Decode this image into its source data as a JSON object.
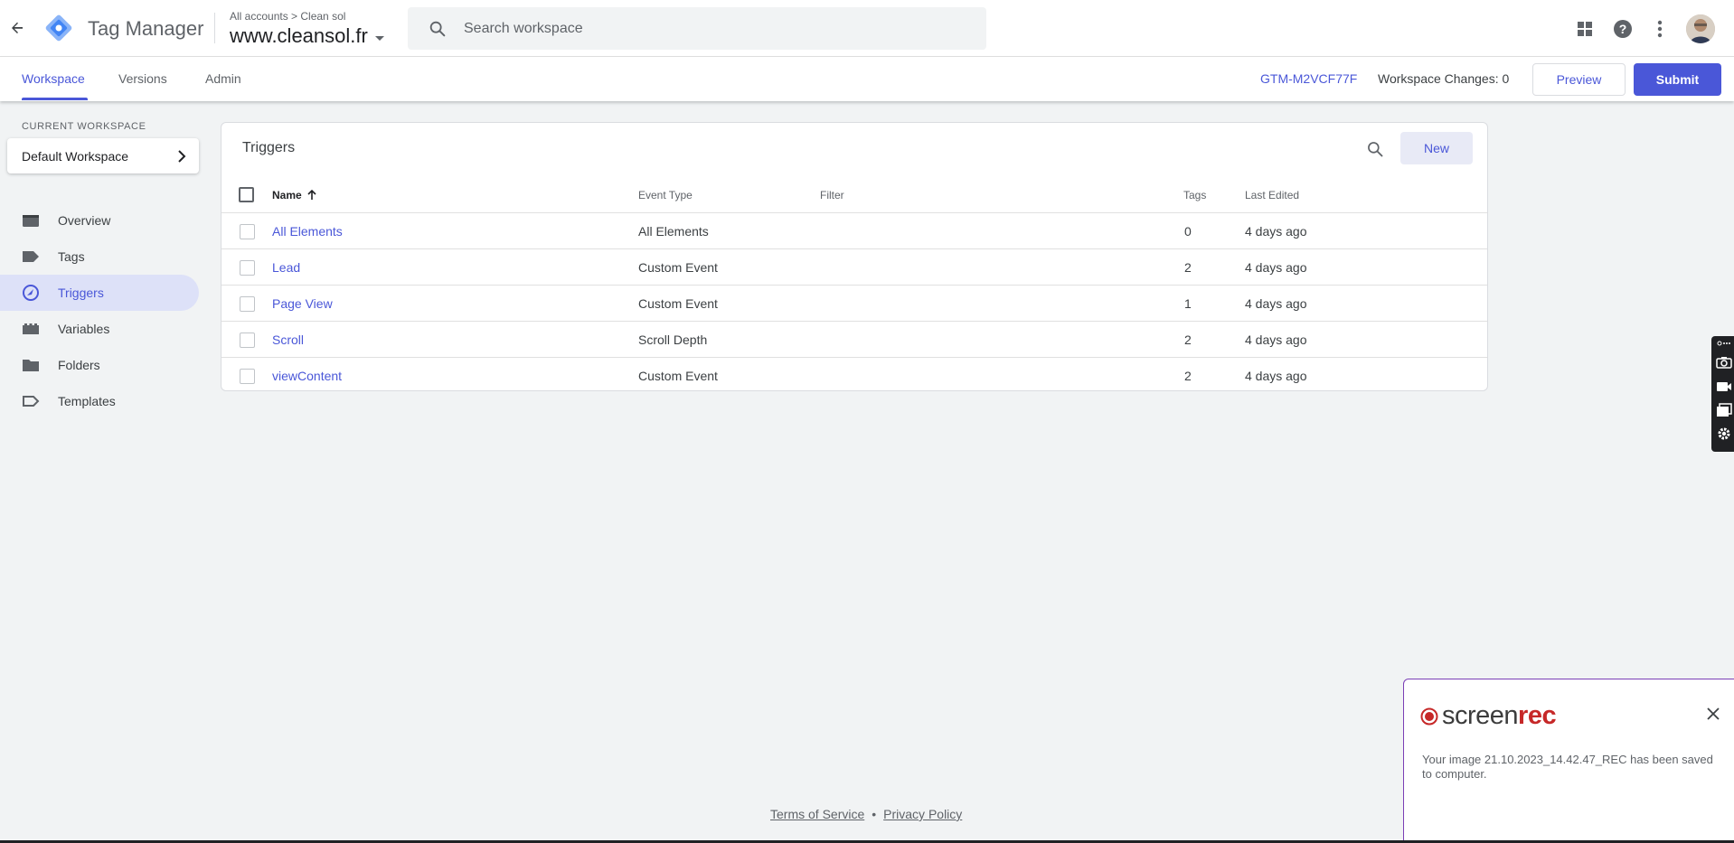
{
  "app": {
    "title": "Tag Manager",
    "breadcrumb": "All accounts > Clean sol",
    "container_name": "www.cleansol.fr"
  },
  "search": {
    "placeholder": "Search workspace"
  },
  "subnav": {
    "tabs": [
      {
        "label": "Workspace",
        "active": true
      },
      {
        "label": "Versions",
        "active": false
      },
      {
        "label": "Admin",
        "active": false
      }
    ],
    "container_id": "GTM-M2VCF77F",
    "workspace_changes": "Workspace Changes: 0",
    "preview_label": "Preview",
    "submit_label": "Submit"
  },
  "sidebar": {
    "current_workspace_label": "CURRENT WORKSPACE",
    "workspace_name": "Default Workspace",
    "items": [
      {
        "label": "Overview",
        "icon": "overview-icon",
        "active": false
      },
      {
        "label": "Tags",
        "icon": "tag-icon",
        "active": false
      },
      {
        "label": "Triggers",
        "icon": "trigger-icon",
        "active": true
      },
      {
        "label": "Variables",
        "icon": "variables-icon",
        "active": false
      },
      {
        "label": "Folders",
        "icon": "folder-icon",
        "active": false
      },
      {
        "label": "Templates",
        "icon": "template-icon",
        "active": false
      }
    ]
  },
  "triggers": {
    "title": "Triggers",
    "new_label": "New",
    "columns": {
      "name": "Name",
      "event_type": "Event Type",
      "filter": "Filter",
      "tags": "Tags",
      "last_edited": "Last Edited"
    },
    "rows": [
      {
        "name": "All Elements",
        "event_type": "All Elements",
        "filter": "",
        "tags": "0",
        "last_edited": "4 days ago"
      },
      {
        "name": "Lead",
        "event_type": "Custom Event",
        "filter": "",
        "tags": "2",
        "last_edited": "4 days ago"
      },
      {
        "name": "Page View",
        "event_type": "Custom Event",
        "filter": "",
        "tags": "1",
        "last_edited": "4 days ago"
      },
      {
        "name": "Scroll",
        "event_type": "Scroll Depth",
        "filter": "",
        "tags": "2",
        "last_edited": "4 days ago"
      },
      {
        "name": "viewContent",
        "event_type": "Custom Event",
        "filter": "",
        "tags": "2",
        "last_edited": "4 days ago"
      }
    ]
  },
  "footer": {
    "terms": "Terms of Service",
    "separator": "•",
    "privacy": "Privacy Policy"
  },
  "notification": {
    "brand_light": "screen",
    "brand_bold": "rec",
    "message": "Your image 21.10.2023_14.42.47_REC has been saved to computer."
  },
  "colors": {
    "accent": "#4a57d8",
    "active_nav_bg": "#dde1f8",
    "screenrec_red": "#c62828",
    "notification_border": "#7b3fb6"
  }
}
